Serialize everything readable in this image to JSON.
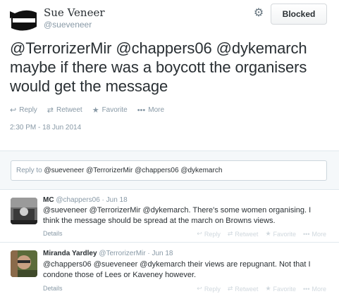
{
  "tweet": {
    "author_name": "Sue Veneer",
    "author_handle": "@sueveneer",
    "blocked_label": "Blocked",
    "text": "@TerrorizerMir @chappers06 @dykemarch maybe if there was a boycott the organisers would get the message",
    "actions": {
      "reply": "Reply",
      "retweet": "Retweet",
      "favorite": "Favorite",
      "more": "More"
    },
    "timestamp": "2:30 PM - 18 Jun 2014"
  },
  "reply_box": {
    "prefix": "Reply to",
    "mentions": "@sueveneer @TerrorizerMir @chappers06 @dykemarch"
  },
  "replies": [
    {
      "name": "MC",
      "handle": "@chappers06",
      "time": "· Jun 18",
      "text": "@sueveneer @TerrorizerMir @dykemarch. There's some women organising. I think the message should be spread at the march on Browns views.",
      "details": "Details",
      "actions": {
        "reply": "Reply",
        "retweet": "Retweet",
        "favorite": "Favorite",
        "more": "More"
      }
    },
    {
      "name": "Miranda Yardley",
      "handle": "@TerrorizerMir",
      "time": "· Jun 18",
      "text": "@chappers06 @sueveneer @dykemarch their views are repugnant. Not that I condone those of Lees or Kaveney however.",
      "details": "Details",
      "actions": {
        "reply": "Reply",
        "retweet": "Retweet",
        "favorite": "Favorite",
        "more": "More"
      }
    }
  ],
  "icons": {
    "gear": "gear-icon",
    "reply": "reply-icon",
    "retweet": "retweet-icon",
    "favorite": "star-icon",
    "more": "more-dots-icon"
  },
  "colors": {
    "text": "#292f33",
    "muted": "#8899a6",
    "reply_bg": "#f5f8fa",
    "border": "#e1e8ed"
  }
}
